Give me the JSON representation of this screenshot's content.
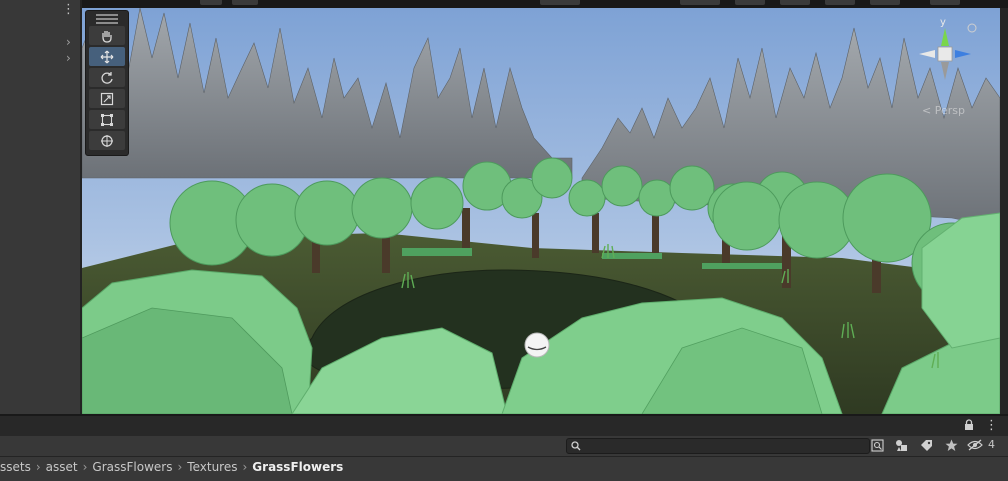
{
  "hierarchy_panel": {
    "menu_icon": "kebab-icon",
    "rows": [
      "chevron-right-icon",
      "chevron-right-icon"
    ]
  },
  "scene_view": {
    "tools": [
      {
        "name": "hand-tool",
        "icon": "hand-icon",
        "active": false
      },
      {
        "name": "move-tool",
        "icon": "move-arrows-icon",
        "active": true
      },
      {
        "name": "rotate-tool",
        "icon": "rotate-icon",
        "active": false
      },
      {
        "name": "scale-tool",
        "icon": "scale-icon",
        "active": false
      },
      {
        "name": "rect-tool",
        "icon": "rect-icon",
        "active": false
      },
      {
        "name": "transform-tool",
        "icon": "transform-icon",
        "active": false
      }
    ],
    "gizmo": {
      "y_label": "y",
      "projection_label": "< Persp"
    },
    "colors": {
      "sky_top": "#7fa3d6",
      "sky_horizon": "#c9d8ea",
      "foliage": "#76c784",
      "foliage_dark": "#4f9b5f",
      "rock": "#8a8f95",
      "ground": "#3d4a2c",
      "water": "#222f22"
    }
  },
  "project": {
    "search": {
      "placeholder": ""
    },
    "hidden_count": "4",
    "breadcrumb": [
      "ssets",
      "asset",
      "GrassFlowers",
      "Textures",
      "GrassFlowers"
    ]
  }
}
